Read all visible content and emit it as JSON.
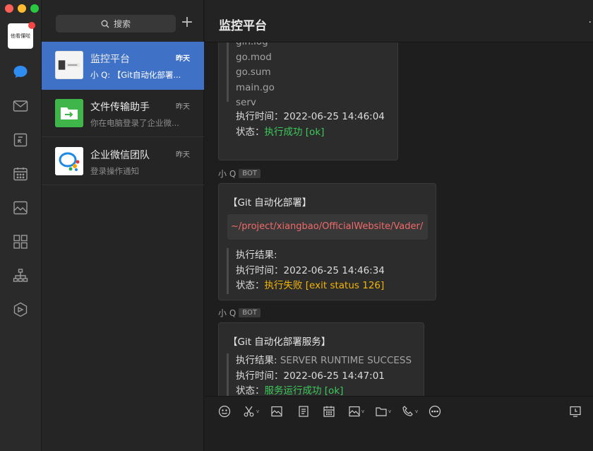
{
  "rail": {
    "avatar_text": "他看懂啦",
    "icons": [
      "chat-icon",
      "mail-icon",
      "docs-icon",
      "calendar-icon",
      "photo-icon",
      "apps-icon",
      "org-chart-icon",
      "cube-icon"
    ]
  },
  "search": {
    "label": "搜索"
  },
  "conversations": [
    {
      "name": "监控平台",
      "time": "昨天",
      "snippet": "小 Q: 【Git自动化部署...",
      "active": true
    },
    {
      "name": "文件传输助手",
      "time": "昨天",
      "snippet": "你在电脑登录了企业微...",
      "active": false
    },
    {
      "name": "企业微信团队",
      "time": "昨天",
      "snippet": "登录操作通知",
      "active": false
    }
  ],
  "chat": {
    "title": "监控平台",
    "messages": [
      {
        "lines": [
          "gin.log",
          "go.mod",
          "go.sum",
          "main.go",
          "serv"
        ],
        "time_label": "执行时间：",
        "time_value": "2022-06-25 14:46:04",
        "status_label": "状态：",
        "status_value": "执行成功 [ok]"
      },
      {
        "sender": "小 Q",
        "badge": "BOT",
        "title": "【Git 自动化部署】",
        "code": "~/project/xiangbao/OfficialWebsite/Vader/",
        "result_label": "执行结果:",
        "result_value": "",
        "time_label": "执行时间：",
        "time_value": "2022-06-25 14:46:34",
        "status_label": "状态：",
        "status_value": "执行失败 [exit status 126]"
      },
      {
        "sender": "小 Q",
        "badge": "BOT",
        "title": "【Git 自动化部署服务】",
        "result_label": "执行结果: ",
        "result_value": "SERVER RUNTIME SUCCESS",
        "time_label": "执行时间：",
        "time_value": "2022-06-25 14:47:01",
        "status_label": "状态：",
        "status_value": "服务运行成功 [ok]"
      }
    ]
  },
  "toolbar": {
    "icons": [
      "emoji-icon",
      "scissors-icon",
      "image-icon",
      "document-icon",
      "calendar-icon",
      "photo-album-icon",
      "folder-icon",
      "phone-icon",
      "more-icon",
      "screen-share-icon"
    ]
  },
  "colors": {
    "accent": "#3f72c7",
    "success": "#3cc95a",
    "warning": "#f2b500",
    "path": "#f06a6a",
    "badge_dot": "#f54545"
  }
}
